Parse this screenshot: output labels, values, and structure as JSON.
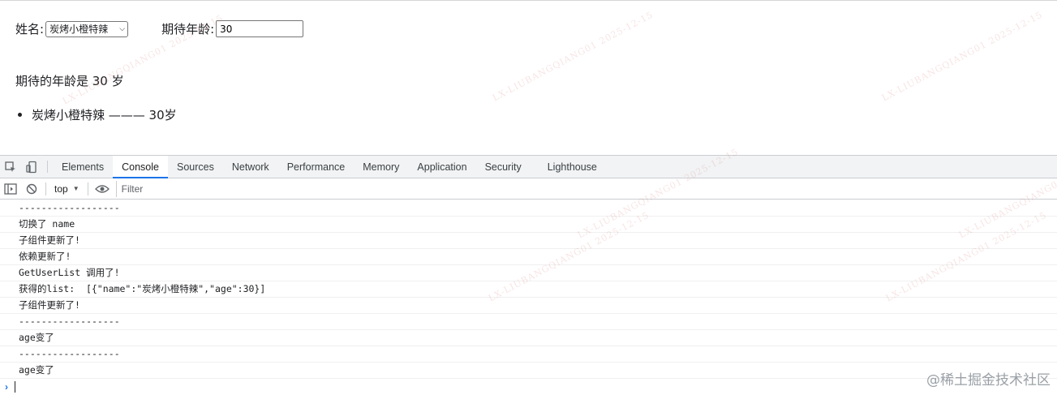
{
  "form": {
    "name_label": "姓名:",
    "name_selected": "炭烤小橙特辣",
    "age_label": "期待年龄:",
    "age_value": "30"
  },
  "expect_text": "期待的年龄是 30 岁",
  "user_list": [
    "炭烤小橙特辣 ——— 30岁"
  ],
  "watermark_text": "LX-LIUBANGQIANG01 2025-12-15",
  "devtools": {
    "tabs": [
      "Elements",
      "Console",
      "Sources",
      "Network",
      "Performance",
      "Memory",
      "Application",
      "Security",
      "Lighthouse"
    ],
    "active_tab": "Console",
    "context": "top",
    "filter_placeholder": "Filter",
    "icons": [
      "inspect-icon",
      "device-toggle-icon",
      "sidebar-toggle-icon",
      "clear-console-icon",
      "eye-icon"
    ]
  },
  "console_logs": [
    "------------------",
    "切换了 name",
    "子组件更新了!",
    "依赖更新了!",
    "GetUserList 调用了!",
    "获得的list:  [{\"name\":\"炭烤小橙特辣\",\"age\":30}]",
    "子组件更新了!",
    "------------------",
    "age变了",
    "------------------",
    "age变了"
  ],
  "brand": "@稀土掘金技术社区"
}
